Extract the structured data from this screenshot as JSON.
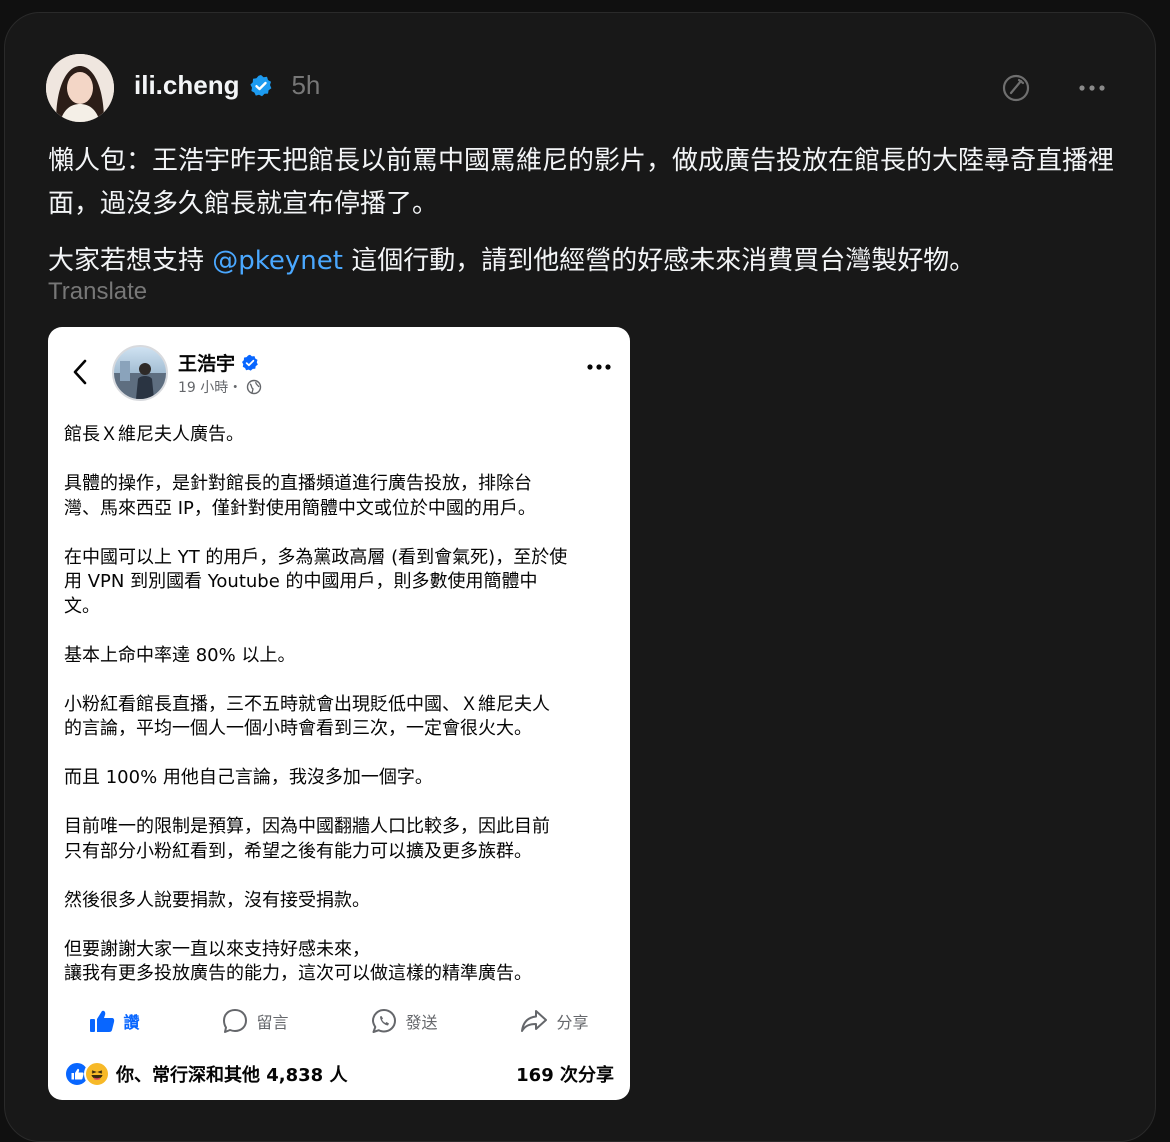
{
  "post": {
    "author": "ili.cheng",
    "time": "5h",
    "paragraph1": "懶人包：王浩宇昨天把館長以前罵中國罵維尼的影片，做成廣告投放在館長的大陸尋奇直播裡面，過沒多久館長就宣布停播了。",
    "paragraph2_before": "大家若想支持 ",
    "mention": "@pkeynet",
    "paragraph2_after": " 這個行動，請到他經營的好感未來消費買台灣製好物。",
    "translate": "Translate"
  },
  "embedded": {
    "name": "王浩宇",
    "meta": "19 小時・",
    "paragraphs": [
      "館長Ｘ維尼夫人廣告。",
      "具體的操作，是針對館長的直播頻道進行廣告投放，排除台\n灣、馬來西亞 IP，僅針對使用簡體中文或位於中國的用戶。",
      "在中國可以上 YT 的用戶，多為黨政高層 (看到會氣死)，至於使\n用 VPN 到別國看 Youtube 的中國用戶，則多數使用簡體中\n文。",
      "基本上命中率達 80% 以上。",
      "小粉紅看館長直播，三不五時就會出現貶低中國、Ｘ維尼夫人\n的言論，平均一個人一個小時會看到三次，一定會很火大。",
      "而且 100% 用他自己言論，我沒多加一個字。",
      "目前唯一的限制是預算，因為中國翻牆人口比較多，因此目前\n只有部分小粉紅看到，希望之後有能力可以擴及更多族群。",
      "然後很多人說要捐款，沒有接受捐款。",
      "但要謝謝大家一直以來支持好感未來，\n讓我有更多投放廣告的能力，這次可以做這樣的精準廣告。"
    ],
    "actions": {
      "like": "讚",
      "comment": "留言",
      "send": "發送",
      "share": "分享"
    },
    "reactions": "你、常行深和其他 4,838 人",
    "shares": "169 次分享"
  },
  "colors": {
    "background": "#101010",
    "card": "#181818",
    "mention": "#4aa8ff",
    "fb_blue": "#0866ff"
  }
}
